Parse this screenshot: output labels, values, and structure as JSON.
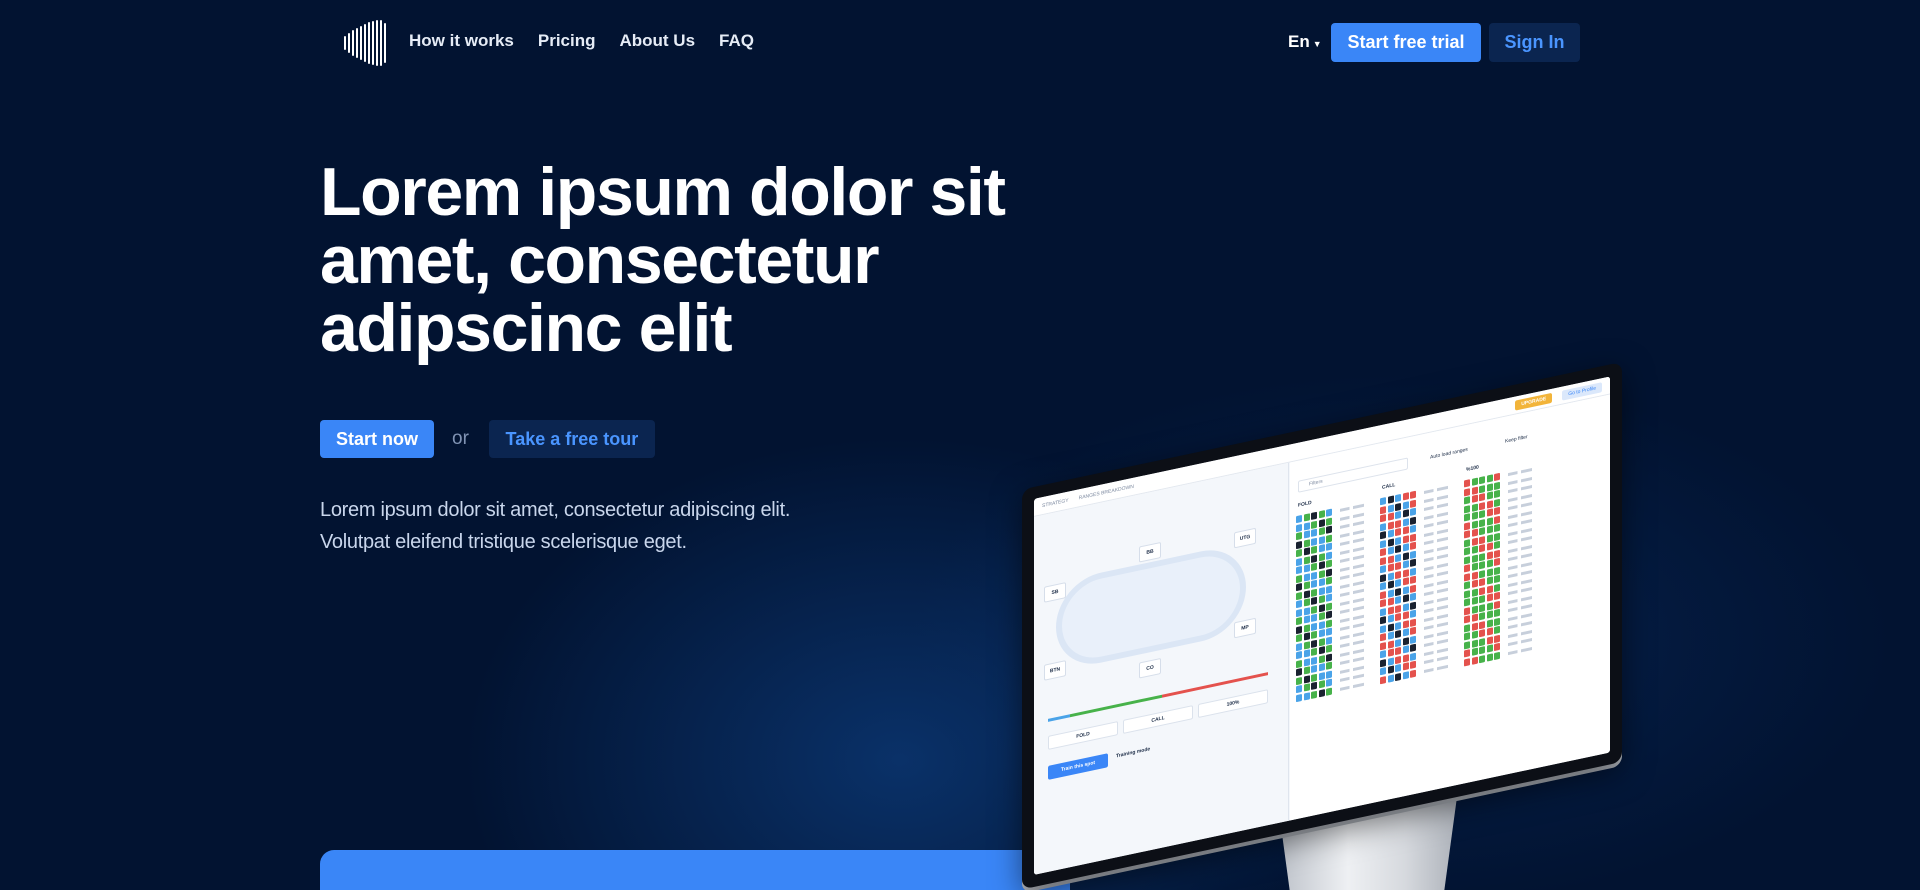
{
  "nav": {
    "links": [
      "How it works",
      "Pricing",
      "About Us",
      "FAQ"
    ],
    "language": "En",
    "start_trial": "Start free trial",
    "sign_in": "Sign In"
  },
  "hero": {
    "title": "Lorem ipsum dolor sit amet, consectetur adipscinc elit",
    "start_now": "Start now",
    "or": "or",
    "take_tour": "Take a free tour",
    "subtitle_line1": "Lorem ipsum dolor sit amet, consectetur adipiscing elit.",
    "subtitle_line2": "Volutpat eleifend tristique scelerisque eget."
  },
  "monitor": {
    "screen_tabs": [
      "STRATEGY",
      "RANGES BREAKDOWN"
    ],
    "upgrade": "UPGRADE",
    "profile": "Go to Profile",
    "filter_placeholder": "Filters",
    "auto_load": "Auto load ranges",
    "keep_filter": "Keep filter",
    "fold_label": "FOLD",
    "call_label": "CALL",
    "raise_label": "%100",
    "positions": [
      "SB",
      "BB",
      "UTG",
      "MP",
      "CO",
      "BTN"
    ],
    "actions": [
      "FOLD",
      "CALL",
      "100%"
    ],
    "train_spot": "Train this spot",
    "training_mode": "Training mode",
    "colors": {
      "fold": "#4aa3e8",
      "call": "#47b24a",
      "raise": "#e4524d",
      "dark": "#1a2230"
    }
  }
}
